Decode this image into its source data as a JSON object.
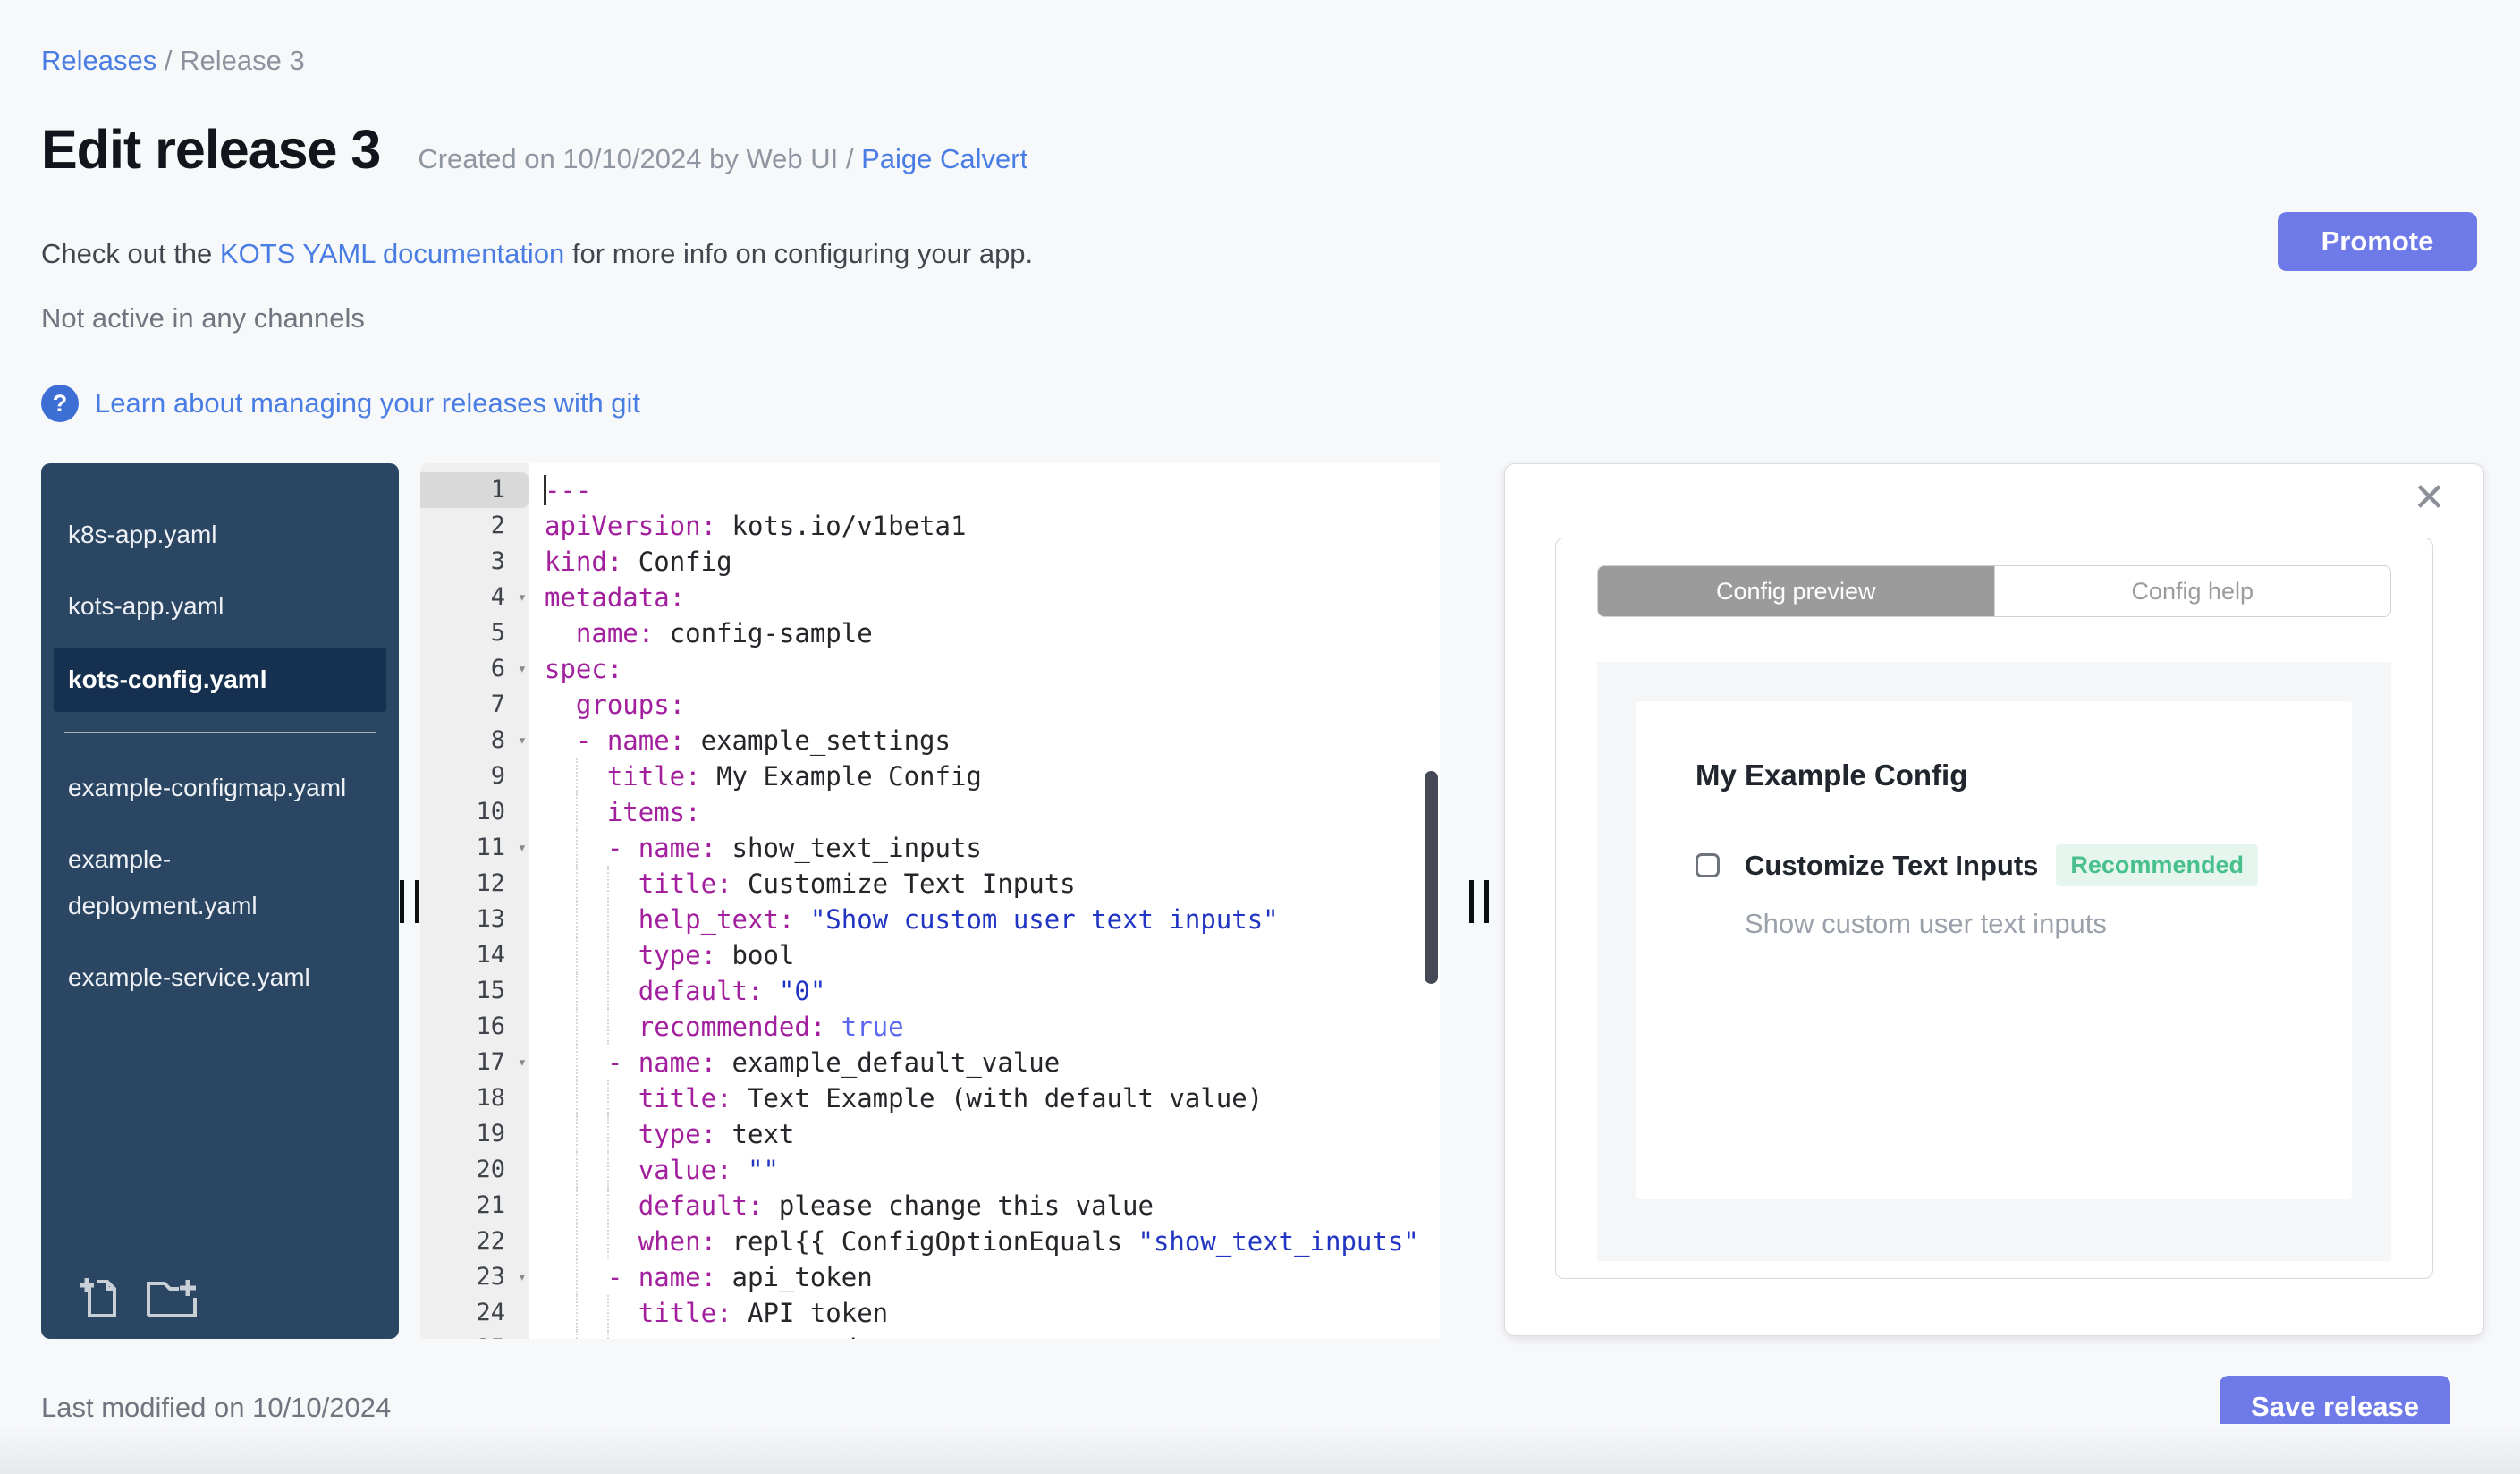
{
  "breadcrumb": {
    "link": "Releases",
    "separator": " / ",
    "current": "Release 3"
  },
  "header": {
    "title": "Edit release 3",
    "created_prefix": "Created on 10/10/2024 by Web UI / ",
    "created_author": "Paige Calvert",
    "promote_label": "Promote"
  },
  "info": {
    "docs_pre": "Check out the ",
    "docs_link": "KOTS YAML documentation",
    "docs_post": " for more info on configuring your app.",
    "channel_status": "Not active in any channels",
    "help_glyph": "?",
    "git_help": "Learn about managing your releases with git"
  },
  "file_tree": {
    "groups": [
      {
        "files": [
          {
            "name": "k8s-app.yaml",
            "selected": false
          },
          {
            "name": "kots-app.yaml",
            "selected": false
          },
          {
            "name": "kots-config.yaml",
            "selected": true
          }
        ]
      },
      {
        "files": [
          {
            "name": "example-configmap.yaml",
            "selected": false
          },
          {
            "name": "example-deployment.yaml",
            "selected": false
          },
          {
            "name": "example-service.yaml",
            "selected": false
          }
        ]
      }
    ],
    "actions": [
      {
        "icon": "new-file-icon"
      },
      {
        "icon": "new-folder-icon"
      }
    ]
  },
  "editor": {
    "active_line": 1,
    "fold_lines": [
      4,
      6,
      8,
      11,
      17,
      23
    ],
    "fold_glyph": "▾",
    "lines": [
      [
        [
          "k",
          "---"
        ]
      ],
      [
        [
          "k",
          "apiVersion:"
        ],
        [
          "t",
          " kots.io/v1beta1"
        ]
      ],
      [
        [
          "k",
          "kind:"
        ],
        [
          "t",
          " Config"
        ]
      ],
      [
        [
          "k",
          "metadata:"
        ]
      ],
      [
        [
          "t",
          "  "
        ],
        [
          "k",
          "name:"
        ],
        [
          "t",
          " config-sample"
        ]
      ],
      [
        [
          "k",
          "spec:"
        ]
      ],
      [
        [
          "t",
          "  "
        ],
        [
          "k",
          "groups:"
        ]
      ],
      [
        [
          "t",
          "  "
        ],
        [
          "d",
          "- "
        ],
        [
          "k",
          "name:"
        ],
        [
          "t",
          " example_settings"
        ]
      ],
      [
        [
          "t",
          "    "
        ],
        [
          "k",
          "title:"
        ],
        [
          "t",
          " My Example Config"
        ]
      ],
      [
        [
          "t",
          "    "
        ],
        [
          "k",
          "items:"
        ]
      ],
      [
        [
          "t",
          "    "
        ],
        [
          "d",
          "- "
        ],
        [
          "k",
          "name:"
        ],
        [
          "t",
          " show_text_inputs"
        ]
      ],
      [
        [
          "t",
          "      "
        ],
        [
          "k",
          "title:"
        ],
        [
          "t",
          " Customize Text Inputs"
        ]
      ],
      [
        [
          "t",
          "      "
        ],
        [
          "k",
          "help_text:"
        ],
        [
          "t",
          " "
        ],
        [
          "s",
          "\"Show custom user text inputs\""
        ]
      ],
      [
        [
          "t",
          "      "
        ],
        [
          "k",
          "type:"
        ],
        [
          "t",
          " bool"
        ]
      ],
      [
        [
          "t",
          "      "
        ],
        [
          "k",
          "default:"
        ],
        [
          "t",
          " "
        ],
        [
          "s",
          "\"0\""
        ]
      ],
      [
        [
          "t",
          "      "
        ],
        [
          "k",
          "recommended:"
        ],
        [
          "t",
          " "
        ],
        [
          "b",
          "true"
        ]
      ],
      [
        [
          "t",
          "    "
        ],
        [
          "d",
          "- "
        ],
        [
          "k",
          "name:"
        ],
        [
          "t",
          " example_default_value"
        ]
      ],
      [
        [
          "t",
          "      "
        ],
        [
          "k",
          "title:"
        ],
        [
          "t",
          " Text Example (with default value)"
        ]
      ],
      [
        [
          "t",
          "      "
        ],
        [
          "k",
          "type:"
        ],
        [
          "t",
          " text"
        ]
      ],
      [
        [
          "t",
          "      "
        ],
        [
          "k",
          "value:"
        ],
        [
          "t",
          " "
        ],
        [
          "s",
          "\"\""
        ]
      ],
      [
        [
          "t",
          "      "
        ],
        [
          "k",
          "default:"
        ],
        [
          "t",
          " please change this value"
        ]
      ],
      [
        [
          "t",
          "      "
        ],
        [
          "k",
          "when:"
        ],
        [
          "t",
          " repl{{ ConfigOptionEquals "
        ],
        [
          "s",
          "\"show_text_inputs\""
        ]
      ],
      [
        [
          "t",
          "    "
        ],
        [
          "d",
          "- "
        ],
        [
          "k",
          "name:"
        ],
        [
          "t",
          " api_token"
        ]
      ],
      [
        [
          "t",
          "      "
        ],
        [
          "k",
          "title:"
        ],
        [
          "t",
          " API token"
        ]
      ],
      [
        [
          "t",
          "      "
        ],
        [
          "k",
          "type:"
        ],
        [
          "t",
          " password"
        ]
      ]
    ]
  },
  "preview": {
    "close_glyph": "✕",
    "tabs": [
      {
        "label": "Config preview",
        "active": true
      },
      {
        "label": "Config help",
        "active": false
      }
    ],
    "group_title": "My Example Config",
    "item": {
      "checked": false,
      "label": "Customize Text Inputs",
      "badge": "Recommended",
      "help": "Show custom user text inputs"
    }
  },
  "footer": {
    "last_modified": "Last modified on 10/10/2024",
    "save_label": "Save release"
  },
  "colors": {
    "accent": "#6e7ae8",
    "link": "#4a7de4",
    "sidebar_bg": "#2b4663",
    "sidebar_selected_bg": "#16314f",
    "badge_green": "#47c08d",
    "yaml_key": "#a21f9d",
    "yaml_string": "#2135c2",
    "yaml_bool": "#5968ee"
  }
}
